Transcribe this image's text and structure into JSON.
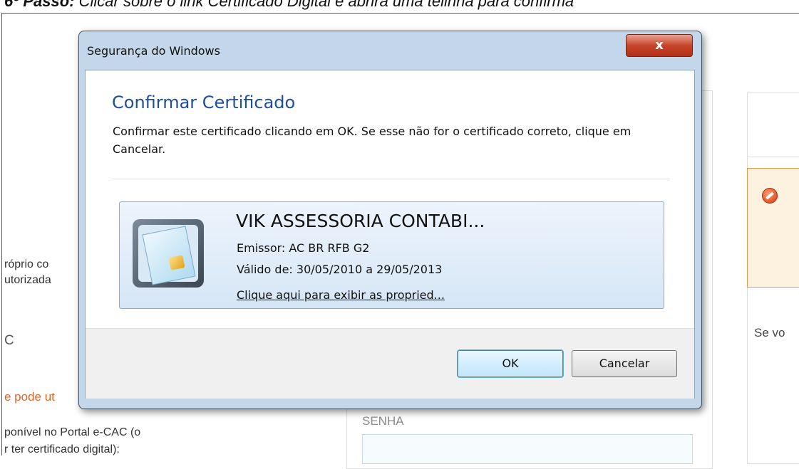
{
  "background": {
    "instruction_prefix": "6º Passo:",
    "instruction_text": " Clicar sobre o link Certificado Digital e abrirá uma telinha para confirma",
    "left_text_1": "róprio co",
    "left_text_2": "utorizada",
    "left_c": "C",
    "left_orange": "e pode ut",
    "left_text_3": "ponível no Portal e-CAC (o",
    "left_text_4": "r ter certificado digital):",
    "senha_label": "SENHA",
    "right_text": "Se vo"
  },
  "dialog": {
    "title": "Segurança do Windows",
    "close_label": "x",
    "heading": "Confirmar Certificado",
    "description": "Confirmar este certificado clicando em OK. Se esse não for o certificado correto, clique em Cancelar.",
    "certificate": {
      "name": "VIK ASSESSORIA CONTABI...",
      "issuer": "Emissor: AC BR RFB G2",
      "validity": "Válido de: 30/05/2010 a 29/05/2013",
      "link": "Clique aqui para exibir as propried..."
    },
    "ok_label": "OK",
    "cancel_label": "Cancelar"
  },
  "icons": {
    "card": "smart-card-icon",
    "stop": "stop-icon"
  },
  "colors": {
    "heading": "#1e4e99",
    "orange_text": "#e0672a",
    "close_button": "#c7442a",
    "card_border": "#84acdd"
  }
}
